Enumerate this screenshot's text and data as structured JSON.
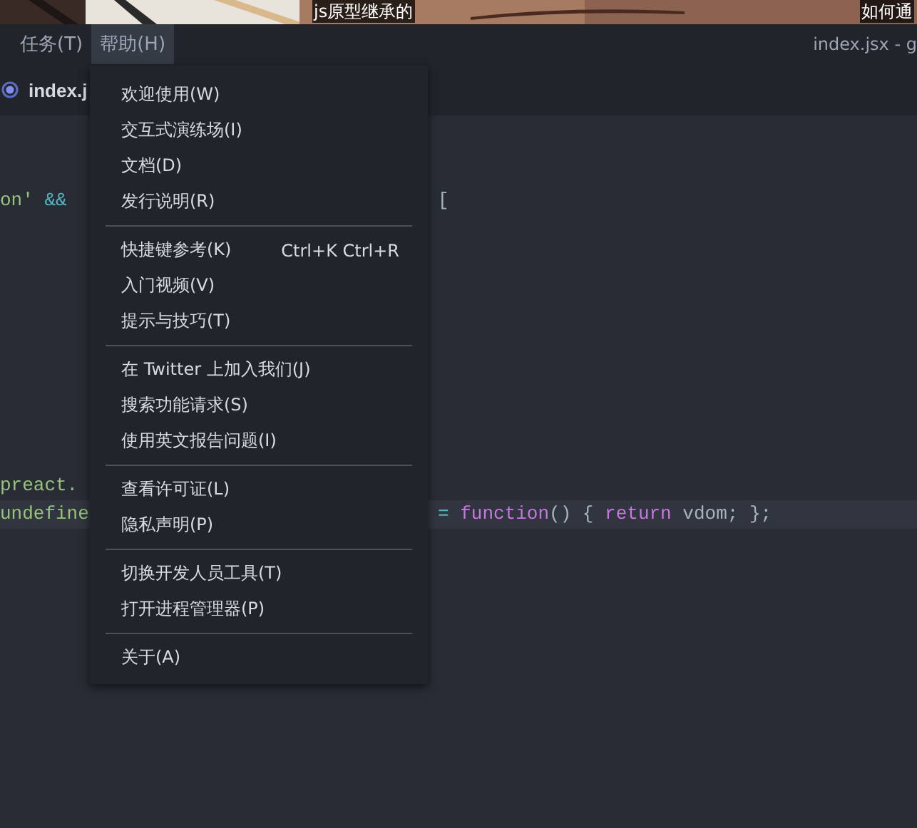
{
  "photo_strip": {
    "captions": [
      "js原型继承的",
      "如何通"
    ]
  },
  "menu_bar": {
    "items": [
      {
        "label": "任务(T)",
        "selected": false
      },
      {
        "label": "帮助(H)",
        "selected": true
      }
    ],
    "window_title": "index.jsx - g"
  },
  "tab": {
    "label": "index.j"
  },
  "editor": {
    "lines": [
      {
        "left": [
          {
            "text": "on'",
            "kind": "string"
          },
          {
            "text": " && ",
            "kind": "operator"
          }
        ],
        "right": [
          {
            "text": "[",
            "kind": "plain"
          }
        ]
      },
      {
        "left": [
          {
            "text": "preact.",
            "kind": "string"
          }
        ]
      },
      {
        "left": [
          {
            "text": "undefine",
            "kind": "string"
          }
        ],
        "right": [
          {
            "text": "= ",
            "kind": "operator"
          },
          {
            "text": "function",
            "kind": "keyword"
          },
          {
            "text": "() { ",
            "kind": "plain"
          },
          {
            "text": "return",
            "kind": "keyword"
          },
          {
            "text": " vdom; };",
            "kind": "plain"
          }
        ],
        "highlighted": true
      }
    ]
  },
  "help_menu": {
    "groups": [
      [
        {
          "label": "欢迎使用(W)"
        },
        {
          "label": "交互式演练场(I)"
        },
        {
          "label": "文档(D)"
        },
        {
          "label": "发行说明(R)"
        }
      ],
      [
        {
          "label": "快捷键参考(K)",
          "shortcut": "Ctrl+K Ctrl+R"
        },
        {
          "label": "入门视频(V)"
        },
        {
          "label": "提示与技巧(T)"
        }
      ],
      [
        {
          "label": "在 Twitter 上加入我们(J)"
        },
        {
          "label": "搜索功能请求(S)"
        },
        {
          "label": "使用英文报告问题(I)"
        }
      ],
      [
        {
          "label": "查看许可证(L)"
        },
        {
          "label": "隐私声明(P)"
        }
      ],
      [
        {
          "label": "切换开发人员工具(T)"
        },
        {
          "label": "打开进程管理器(P)"
        }
      ],
      [
        {
          "label": "关于(A)"
        }
      ]
    ]
  }
}
